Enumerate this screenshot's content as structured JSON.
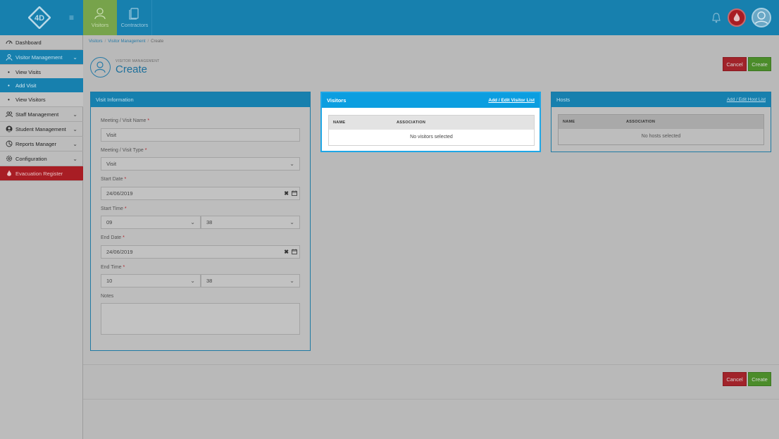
{
  "header": {
    "nav_tiles": [
      {
        "label": "Visitors",
        "icon": "person-icon",
        "active": true
      },
      {
        "label": "Contractors",
        "icon": "document-icon",
        "active": false
      }
    ],
    "logo_text": "4D"
  },
  "sidebar": {
    "items": [
      {
        "label": "Dashboard",
        "icon": "dashboard-icon"
      },
      {
        "label": "Visitor Management",
        "icon": "person-icon",
        "expanded": true
      },
      {
        "label": "View Visits"
      },
      {
        "label": "Add Visit",
        "active": true
      },
      {
        "label": "View Visitors"
      },
      {
        "label": "Staff Management",
        "icon": "staff-icon"
      },
      {
        "label": "Student Management",
        "icon": "student-icon"
      },
      {
        "label": "Reports Manager",
        "icon": "reports-icon"
      },
      {
        "label": "Configuration",
        "icon": "gear-icon"
      },
      {
        "label": "Evacuation Register",
        "icon": "flame-icon"
      }
    ]
  },
  "breadcrumb": [
    "Visitors",
    "Visitor Management",
    "Create"
  ],
  "page": {
    "subtitle": "VISITOR MANAGEMENT",
    "title": "Create",
    "cancel_label": "Cancel",
    "create_label": "Create"
  },
  "visit_info": {
    "title": "Visit Information",
    "name_label": "Meeting / Visit Name",
    "name_value": "Visit",
    "type_label": "Meeting / Visit Type",
    "type_value": "Visit",
    "start_date_label": "Start Date",
    "start_date_value": "24/06/2019",
    "start_time_label": "Start Time",
    "start_hour": "09",
    "start_minute": "38",
    "end_date_label": "End Date",
    "end_date_value": "24/06/2019",
    "end_time_label": "End Time",
    "end_hour": "10",
    "end_minute": "38",
    "notes_label": "Notes",
    "required_mark": "*"
  },
  "visitors_panel": {
    "title": "Visitors",
    "link": "Add / Edit Visitor List",
    "col_name": "NAME",
    "col_association": "ASSOCIATION",
    "empty": "No visitors selected"
  },
  "hosts_panel": {
    "title": "Hosts",
    "link": "Add / Edit Host List",
    "col_name": "NAME",
    "col_association": "ASSOCIATION",
    "empty": "No hosts selected"
  },
  "colors": {
    "header_blue": "#1780ae",
    "active_green": "#77a34b",
    "cancel_red": "#a1232a",
    "create_green": "#4b8c2a",
    "highlight_blue": "#0b9ee0"
  }
}
